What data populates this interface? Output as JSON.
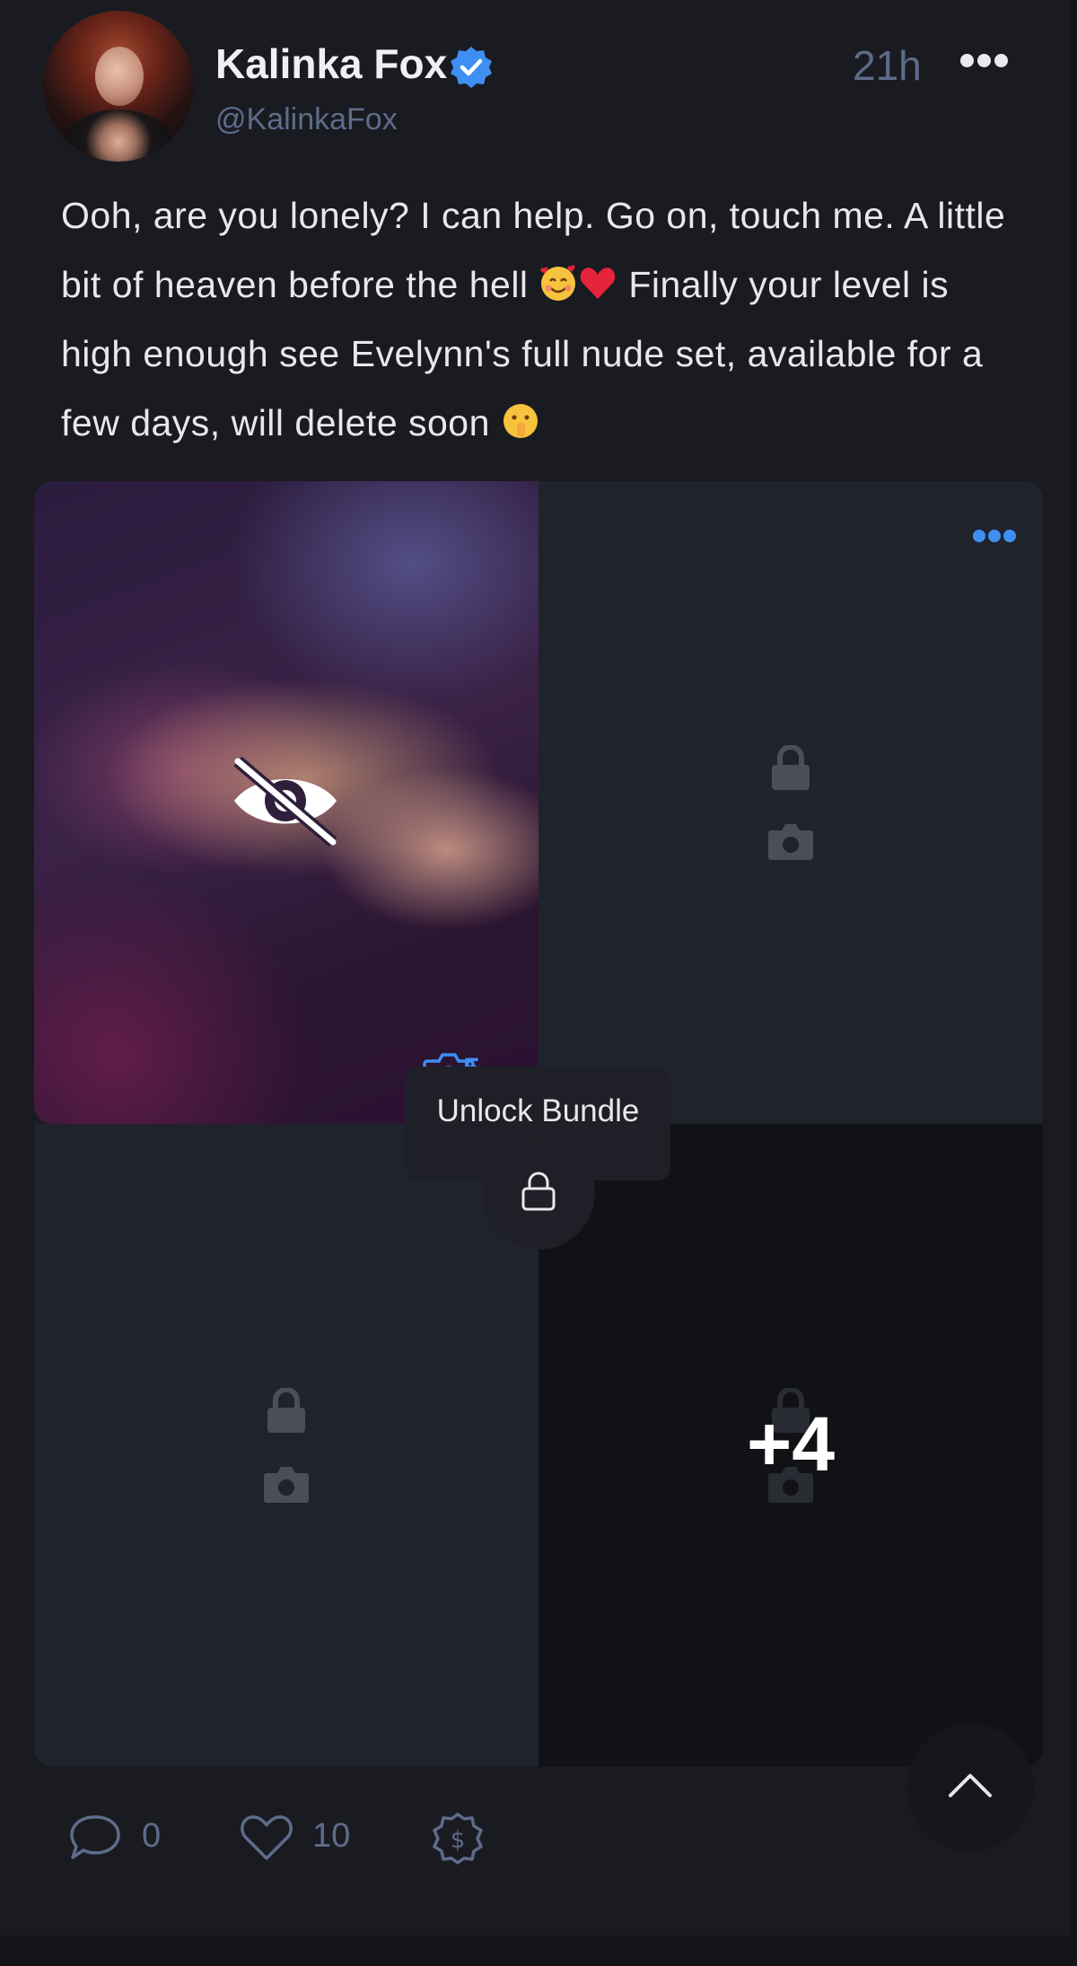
{
  "post": {
    "author_name": "Kalinka Fox",
    "author_handle": "@KalinkaFox",
    "verified": true,
    "time_ago": "21h",
    "caption_part1": "Ooh, are you lonely? I can help. Go on, touch me. A little bit of heaven before the hell ",
    "caption_part2": " Finally your level is high enough see Evelynn's full nude set, available for a few days, will delete soon ",
    "emojis": [
      "smiling-face-with-hearts",
      "red-heart",
      "shushing-face"
    ]
  },
  "media": {
    "count": "5",
    "more_count_label": "+4",
    "unlock_label": "Unlock Bundle"
  },
  "footer": {
    "comments": "0",
    "likes": "10"
  },
  "colors": {
    "accent": "#3f8ef2",
    "muted": "#5e6b8a",
    "background": "#191b21"
  }
}
